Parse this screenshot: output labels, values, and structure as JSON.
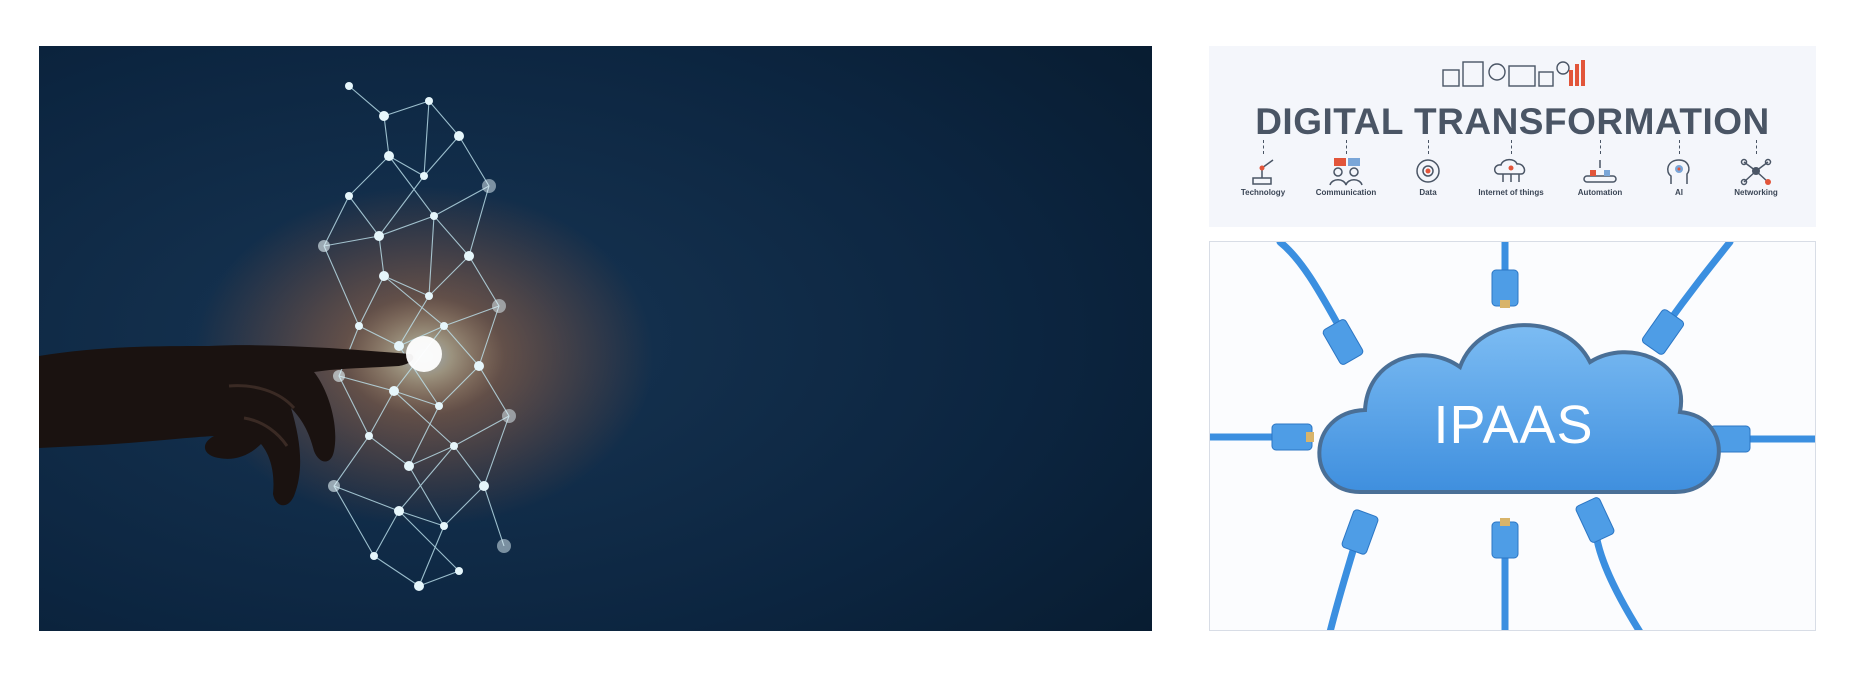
{
  "hero": {
    "description_icon": "hand-touching-network-icon",
    "colors": {
      "background": "#0a2036",
      "glow": "#ff9a4a",
      "network": "#bfe4ef"
    }
  },
  "banner": {
    "title": "DIGITAL TRANSFORMATION",
    "items": [
      {
        "label": "Technology",
        "icon": "robot-arm-icon"
      },
      {
        "label": "Communication",
        "icon": "people-chat-icon"
      },
      {
        "label": "Data",
        "icon": "data-gear-icon"
      },
      {
        "label": "Internet of things",
        "icon": "cloud-network-icon"
      },
      {
        "label": "Automation",
        "icon": "conveyor-icon"
      },
      {
        "label": "AI",
        "icon": "ai-head-icon"
      },
      {
        "label": "Networking",
        "icon": "network-nodes-icon"
      }
    ],
    "colors": {
      "text": "#4a5565",
      "accent": "#e2553a",
      "background": "#f4f6fb"
    }
  },
  "ipaas": {
    "cloud_label": "IPAAS",
    "icon": "cloud-with-cables-icon",
    "colors": {
      "cloud": "#5aa6e8",
      "cable": "#3b8fe0",
      "background": "#fbfcfe"
    }
  }
}
